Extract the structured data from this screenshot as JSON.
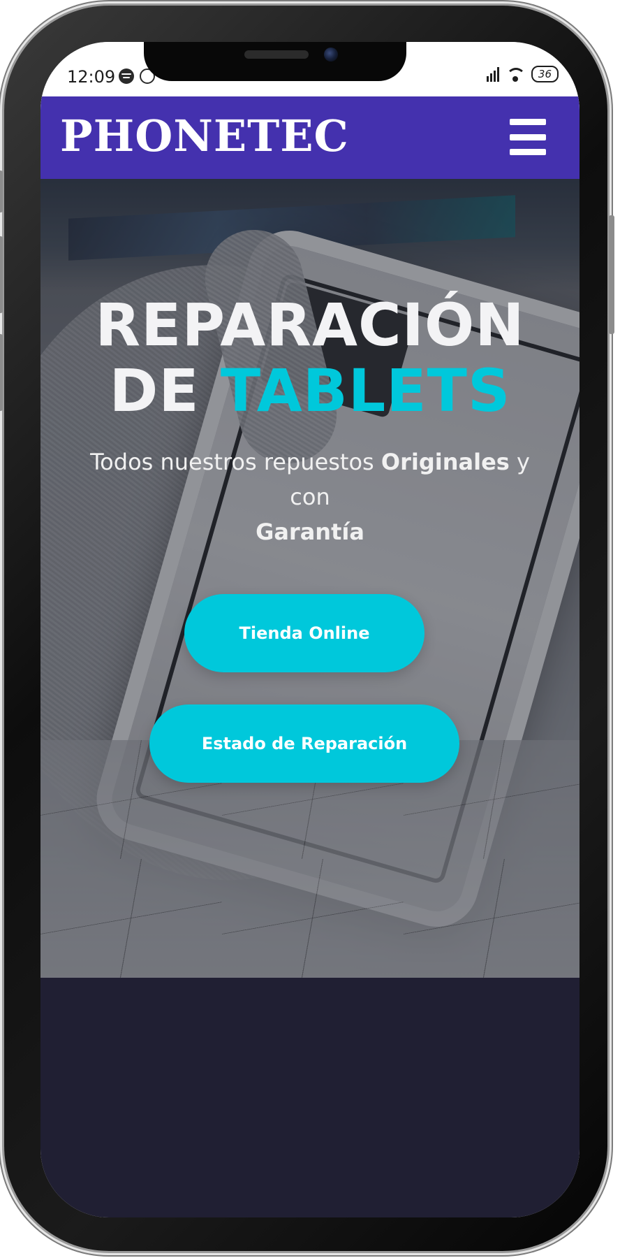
{
  "status_bar": {
    "time": "12:09",
    "battery": "36",
    "icons_left": [
      "spotify-icon",
      "whatsapp-icon"
    ],
    "icons_right": [
      "signal-icon",
      "wifi-icon",
      "battery-icon"
    ]
  },
  "header": {
    "logo": "PHONETEC",
    "menu_icon": "hamburger-menu-icon",
    "bg_color": "#4431ae"
  },
  "hero": {
    "title_line1": "REPARACIÓN",
    "title_line2_part1": "DE ",
    "title_line2_accent": "TABLETS",
    "subtitle_pre": "Todos nuestros repuestos ",
    "subtitle_bold1": "Originales",
    "subtitle_mid": " y con ",
    "subtitle_bold2": "Garantía",
    "accent_color": "#00c8db"
  },
  "buttons": {
    "store": "Tienda Online",
    "repair_status": "Estado de Reparación"
  }
}
